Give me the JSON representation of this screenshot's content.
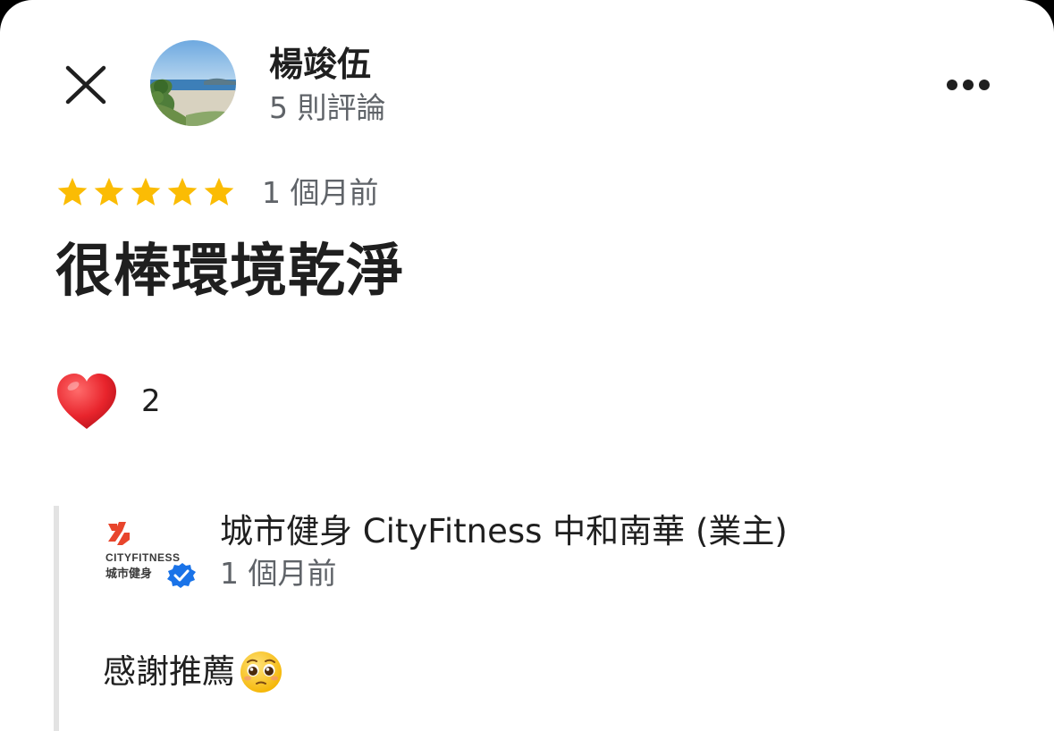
{
  "header": {
    "close_icon": "close-icon",
    "author_name": "楊竣伍",
    "review_count": "5 則評論",
    "more_icon": "more-horizontal-icon"
  },
  "review": {
    "rating": 5,
    "rating_max": 5,
    "star_color": "#fbbc04",
    "time": "1 個月前",
    "text": "很棒環境乾淨",
    "reaction_icon": "heart-icon",
    "reaction_count": "2"
  },
  "owner_reply": {
    "name": "城市健身 CityFitness 中和南華 (業主)",
    "time": "1 個月前",
    "text": "感謝推薦",
    "logo_brand_text": "CITYFITNESS",
    "logo_cn_text": "城市健身",
    "verified_icon": "verified-badge-icon",
    "verified_color": "#1a73e8",
    "brand_color": "#e8452c",
    "emoji_icon": "pleading-face-icon"
  }
}
